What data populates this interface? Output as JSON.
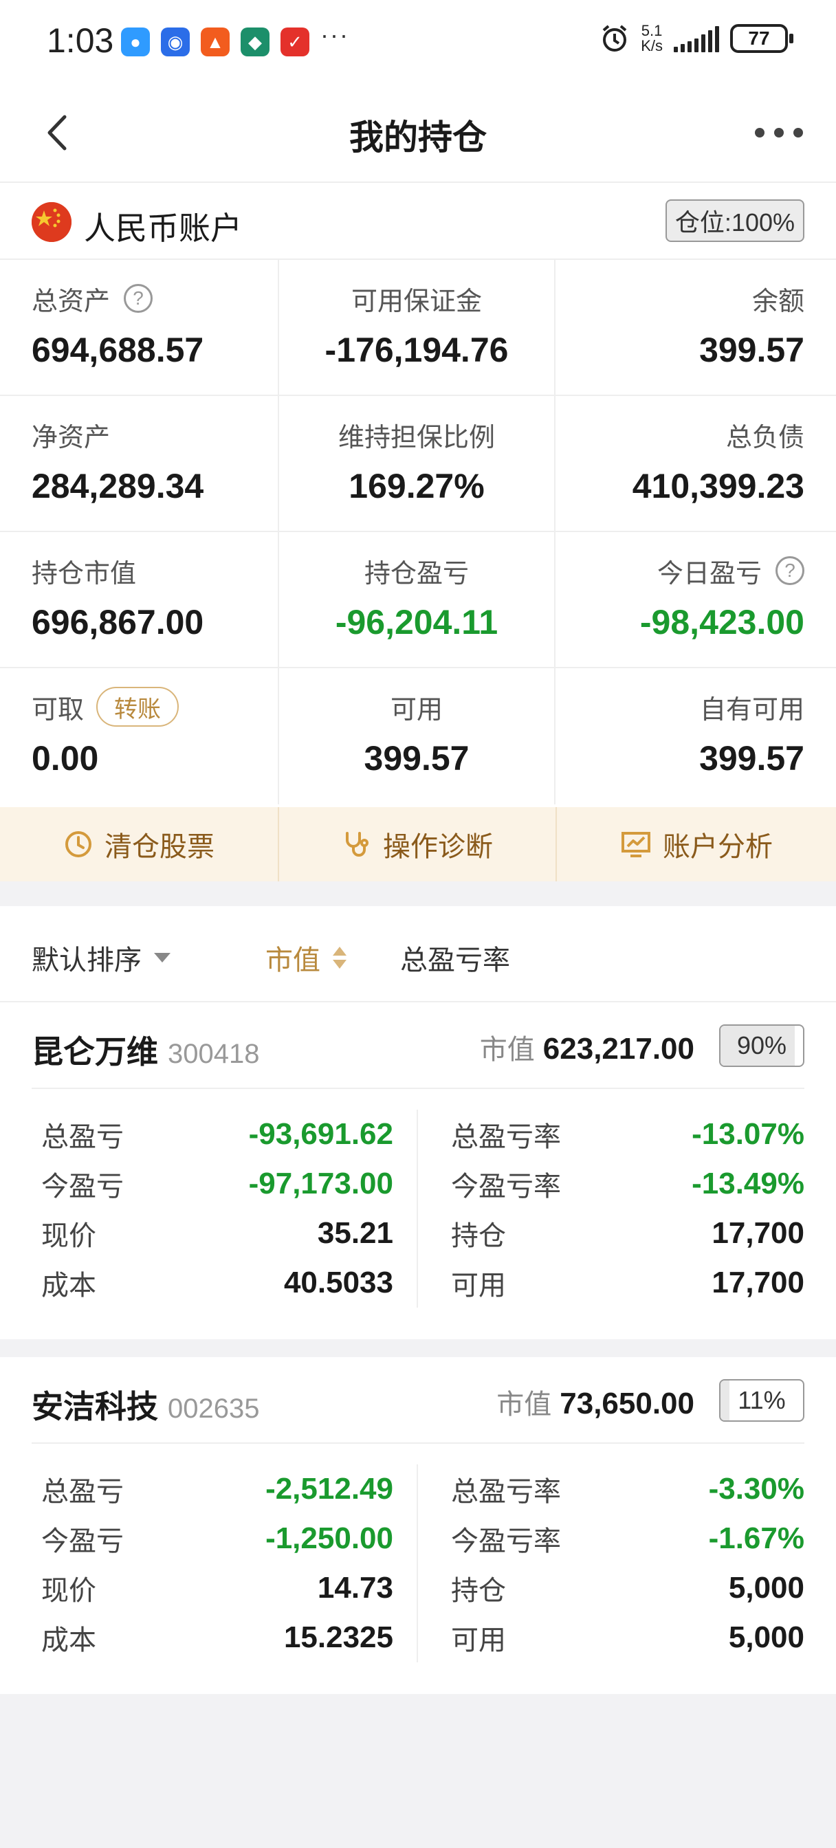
{
  "status_bar": {
    "time": "1:03",
    "apps": [
      {
        "name": "message-app-icon",
        "glyph": "●",
        "color": "#2f9bff"
      },
      {
        "name": "browser-app-icon",
        "glyph": "◉",
        "color": "#2b6de8"
      },
      {
        "name": "flag-app-icon",
        "glyph": "▲",
        "color": "#f25c1e"
      },
      {
        "name": "leaf-app-icon",
        "glyph": "◆",
        "color": "#1c8f6a"
      },
      {
        "name": "bolt-app-icon",
        "glyph": "✓",
        "color": "#e4312b"
      }
    ],
    "more": "···",
    "speed_value": "5.1",
    "speed_unit": "K/s",
    "battery": "77"
  },
  "nav": {
    "title": "我的持仓"
  },
  "account": {
    "title": "人民币账户",
    "position_badge": "仓位:100%",
    "metrics": [
      {
        "label": "总资产",
        "value": "694,688.57",
        "help": "?"
      },
      {
        "label": "可用保证金",
        "value": "-176,194.76"
      },
      {
        "label": "余额",
        "value": "399.57"
      },
      {
        "label": "净资产",
        "value": "284,289.34"
      },
      {
        "label": "维持担保比例",
        "value": "169.27%"
      },
      {
        "label": "总负债",
        "value": "410,399.23"
      },
      {
        "label": "持仓市值",
        "value": "696,867.00"
      },
      {
        "label": "持仓盈亏",
        "value": "-96,204.11"
      },
      {
        "label": "今日盈亏",
        "value": "-98,423.00",
        "help": "?"
      },
      {
        "label": "可取",
        "value": "0.00",
        "button": "转账"
      },
      {
        "label": "可用",
        "value": "399.57"
      },
      {
        "label": "自有可用",
        "value": "399.57"
      }
    ],
    "actions": [
      {
        "label": "清仓股票"
      },
      {
        "label": "操作诊断"
      },
      {
        "label": "账户分析"
      }
    ],
    "colors": {
      "loss": "#1a9a2e",
      "accent": "#b8893d",
      "action_bg": "#fbf3e6"
    }
  },
  "sort": {
    "default": "默认排序",
    "market_value": "市值",
    "total_rate": "总盈亏率"
  },
  "holdings": [
    {
      "name": "昆仑万维",
      "code": "300418",
      "mv_label": "市值",
      "market_value": "623,217.00",
      "pct_label": "90%",
      "pct": 0.9,
      "left": [
        {
          "k": "总盈亏",
          "v": "-93,691.62",
          "green": true
        },
        {
          "k": "今盈亏",
          "v": "-97,173.00",
          "green": true
        },
        {
          "k": "现价",
          "v": "35.21"
        },
        {
          "k": "成本",
          "v": "40.5033"
        }
      ],
      "right": [
        {
          "k": "总盈亏率",
          "v": "-13.07%",
          "green": true
        },
        {
          "k": "今盈亏率",
          "v": "-13.49%",
          "green": true
        },
        {
          "k": "持仓",
          "v": "17,700"
        },
        {
          "k": "可用",
          "v": "17,700"
        }
      ]
    },
    {
      "name": "安洁科技",
      "code": "002635",
      "mv_label": "市值",
      "market_value": "73,650.00",
      "pct_label": "11%",
      "pct": 0.11,
      "left": [
        {
          "k": "总盈亏",
          "v": "-2,512.49",
          "green": true
        },
        {
          "k": "今盈亏",
          "v": "-1,250.00",
          "green": true
        },
        {
          "k": "现价",
          "v": "14.73"
        },
        {
          "k": "成本",
          "v": "15.2325"
        }
      ],
      "right": [
        {
          "k": "总盈亏率",
          "v": "-3.30%",
          "green": true
        },
        {
          "k": "今盈亏率",
          "v": "-1.67%",
          "green": true
        },
        {
          "k": "持仓",
          "v": "5,000"
        },
        {
          "k": "可用",
          "v": "5,000"
        }
      ]
    }
  ]
}
